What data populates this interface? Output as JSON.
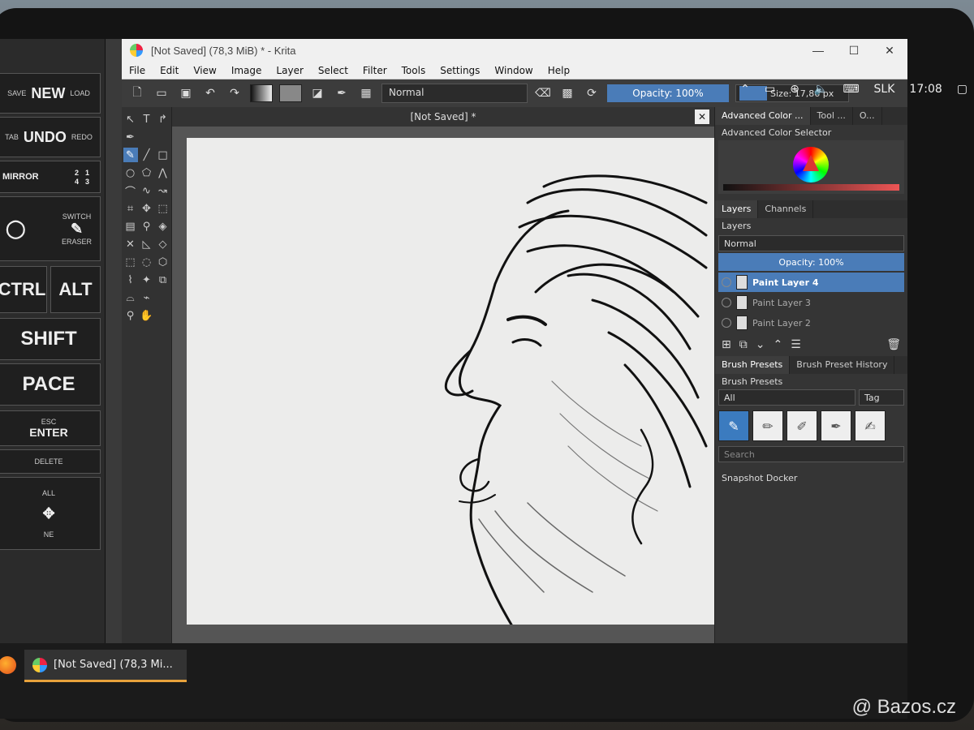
{
  "window": {
    "title": "[Not Saved]  (78,3 MiB)  * - Krita",
    "minimize": "—",
    "maximize": "☐",
    "close": "✕"
  },
  "menu": [
    "File",
    "Edit",
    "View",
    "Image",
    "Layer",
    "Select",
    "Filter",
    "Tools",
    "Settings",
    "Window",
    "Help"
  ],
  "toolbar": {
    "blend_mode": "Normal",
    "opacity": "Opacity: 100%",
    "size": "Size: 17,86 px"
  },
  "document_tab": {
    "label": "[Not Saved]  *"
  },
  "touch_docker": {
    "new": "NEW",
    "save": "SAVE",
    "load": "LOAD",
    "undo": "UNDO",
    "tab": "TAB",
    "redo": "REDO",
    "mirror": "MIRROR",
    "switch": "SWITCH",
    "eraser": "ERASER",
    "ctrl": "CTRL",
    "alt": "ALT",
    "shift": "SHIFT",
    "space": "PACE",
    "esc": "ESC",
    "enter": "ENTER",
    "delete": "DELETE",
    "all": "ALL",
    "none": "NE",
    "numbers": [
      "2",
      "1",
      "4",
      "3"
    ]
  },
  "dockers": {
    "color_tabs": [
      "Advanced Color ...",
      "Tool ...",
      "O..."
    ],
    "color_title": "Advanced Color Selector",
    "layer_tabs": [
      "Layers",
      "Channels"
    ],
    "layers_title": "Layers",
    "layer_blend": "Normal",
    "layer_opacity": "Opacity:  100%",
    "layers": [
      {
        "name": "Paint Layer 4",
        "active": true
      },
      {
        "name": "Paint Layer 3",
        "active": false
      },
      {
        "name": "Paint Layer 2",
        "active": false
      }
    ],
    "brush_tabs": [
      "Brush Presets",
      "Brush Preset History"
    ],
    "brush_title": "Brush Presets",
    "brush_filter": "All",
    "tag_label": "Tag",
    "search_placeholder": "Search",
    "snapshot_title": "Snapshot Docker"
  },
  "taskbar": {
    "app_label": "[Not Saved]  (78,3 Mi...",
    "language": "SLK",
    "time": "17:08"
  },
  "watermark": "Bazos.cz",
  "colors": {
    "accent": "#4a7cb8",
    "taskbar_active": "#e8a23c"
  }
}
